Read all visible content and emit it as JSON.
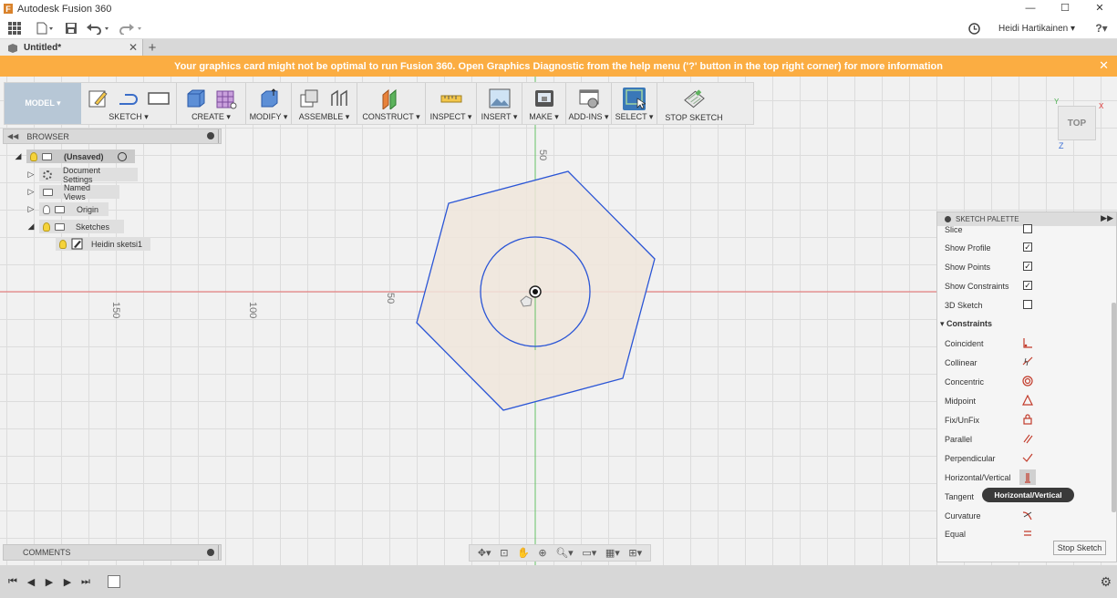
{
  "app": {
    "title": "Autodesk Fusion 360",
    "logo_letter": "F",
    "window_controls": [
      "—",
      "☐",
      "✕"
    ]
  },
  "qat": {
    "user_name": "Heidi Hartikainen ▾",
    "help": "?▾",
    "icons": [
      "grid-icon",
      "file-icon",
      "save-icon",
      "undo-icon",
      "redo-icon",
      "clock-icon",
      "help-icon"
    ]
  },
  "tabs": [
    {
      "label": "Untitled*",
      "close": "✕"
    }
  ],
  "new_tab": "+",
  "banner": {
    "message": "Your graphics card might not be optimal to run Fusion 360. Open Graphics Diagnostic from the help menu ('?' button in the top right corner) for more information",
    "close": "✕",
    "color": "#fbad42"
  },
  "ribbon": {
    "mode": "MODEL ▾",
    "groups": [
      {
        "label": "SKETCH ▾"
      },
      {
        "label": "CREATE ▾"
      },
      {
        "label": "MODIFY ▾"
      },
      {
        "label": "ASSEMBLE ▾"
      },
      {
        "label": "CONSTRUCT ▾"
      },
      {
        "label": "INSPECT ▾"
      },
      {
        "label": "INSERT ▾"
      },
      {
        "label": "MAKE ▾"
      },
      {
        "label": "ADD-INS ▾"
      },
      {
        "label": "SELECT ▾"
      },
      {
        "label": "STOP SKETCH"
      }
    ]
  },
  "browser": {
    "title": "BROWSER",
    "items": [
      {
        "label": "(Unsaved)"
      },
      {
        "label": "Document Settings"
      },
      {
        "label": "Named Views"
      },
      {
        "label": "Origin"
      },
      {
        "label": "Sketches"
      },
      {
        "label": "Heidin sketsi1"
      }
    ]
  },
  "comments": {
    "title": "COMMENTS"
  },
  "canvas": {
    "ruler_labels": [
      "50",
      "150",
      "100",
      "50"
    ],
    "sketch_fill": "#f0e6dc",
    "sketch_line": "#2a55d6",
    "axis_x_color": "#e66a6a",
    "axis_y_color": "#66c266"
  },
  "viewcube": {
    "face": "TOP",
    "axis_y": "Y",
    "axis_x": "X",
    "axis_z": "Z"
  },
  "palette": {
    "title": "SKETCH PALETTE",
    "options": [
      {
        "label": "Slice",
        "checked": false
      },
      {
        "label": "Show Profile",
        "checked": true
      },
      {
        "label": "Show Points",
        "checked": true
      },
      {
        "label": "Show Constraints",
        "checked": true
      },
      {
        "label": "3D Sketch",
        "checked": false
      }
    ],
    "constraints_title": "▾ Constraints",
    "constraints": [
      {
        "label": "Coincident"
      },
      {
        "label": "Collinear"
      },
      {
        "label": "Concentric"
      },
      {
        "label": "Midpoint"
      },
      {
        "label": "Fix/UnFix"
      },
      {
        "label": "Parallel"
      },
      {
        "label": "Perpendicular"
      },
      {
        "label": "Horizontal/Vertical"
      },
      {
        "label": "Tangent"
      },
      {
        "label": "Curvature"
      },
      {
        "label": "Equal"
      }
    ],
    "tooltip": "Horizontal/Vertical",
    "stop_sketch": "Stop Sketch",
    "check_glyph": "✓"
  },
  "navbar": {
    "icons": [
      "orbit-icon",
      "look-at-icon",
      "pan-icon",
      "zoom-window-icon",
      "zoom-icon",
      "display-settings-icon",
      "grid-settings-icon",
      "viewports-icon"
    ]
  }
}
